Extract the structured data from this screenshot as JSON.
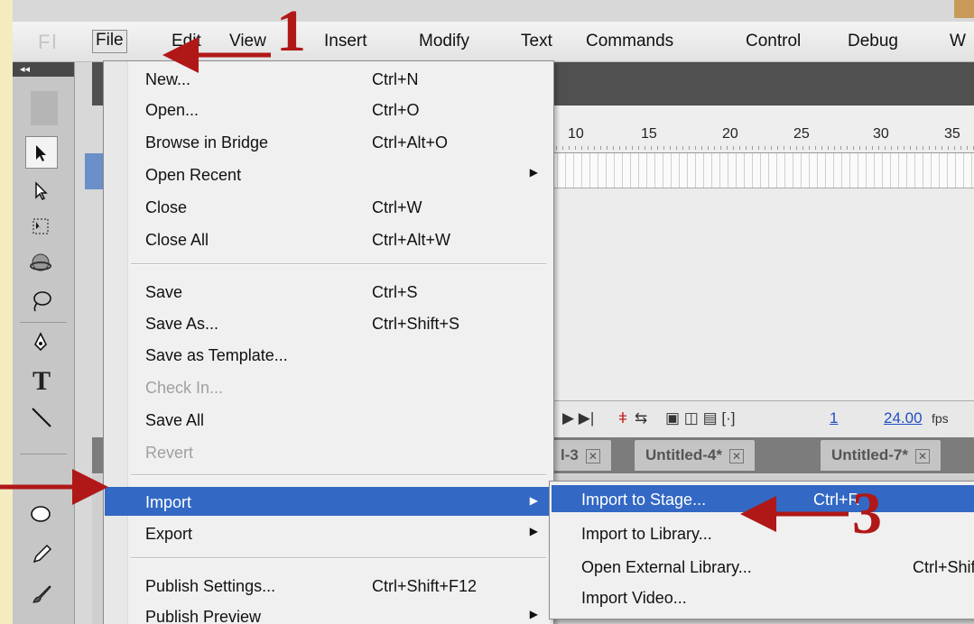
{
  "app": {
    "logo": "Fl"
  },
  "menubar": {
    "items": [
      {
        "label": "File"
      },
      {
        "label": "Edit"
      },
      {
        "label": "View"
      },
      {
        "label": "Insert"
      },
      {
        "label": "Modify"
      },
      {
        "label": "Text"
      },
      {
        "label": "Commands"
      },
      {
        "label": "Control"
      },
      {
        "label": "Debug"
      },
      {
        "label": "W"
      }
    ]
  },
  "toolbar": {
    "collapse_label": "◂◂"
  },
  "timeline": {
    "ruler": [
      "10",
      "15",
      "20",
      "25",
      "30",
      "35"
    ],
    "frame": "1",
    "fps_value": "24.00",
    "fps_unit": "fps"
  },
  "doc_tabs": [
    {
      "label": "l-3"
    },
    {
      "label": "Untitled-4*"
    },
    {
      "label": "Untitled-7*"
    }
  ],
  "file_menu": {
    "items": [
      {
        "label": "New...",
        "shortcut": "Ctrl+N"
      },
      {
        "label": "Open...",
        "shortcut": "Ctrl+O"
      },
      {
        "label": "Browse in Bridge",
        "shortcut": "Ctrl+Alt+O"
      },
      {
        "label": "Open Recent",
        "shortcut": ""
      },
      {
        "label": "Close",
        "shortcut": "Ctrl+W"
      },
      {
        "label": "Close All",
        "shortcut": "Ctrl+Alt+W"
      },
      {
        "label": "Save",
        "shortcut": "Ctrl+S"
      },
      {
        "label": "Save As...",
        "shortcut": "Ctrl+Shift+S"
      },
      {
        "label": "Save as Template...",
        "shortcut": ""
      },
      {
        "label": "Check In...",
        "shortcut": ""
      },
      {
        "label": "Save All",
        "shortcut": ""
      },
      {
        "label": "Revert",
        "shortcut": ""
      },
      {
        "label": "Import",
        "shortcut": ""
      },
      {
        "label": "Export",
        "shortcut": ""
      },
      {
        "label": "Publish Settings...",
        "shortcut": "Ctrl+Shift+F12"
      },
      {
        "label": "Publish Preview",
        "shortcut": ""
      }
    ]
  },
  "import_submenu": {
    "items": [
      {
        "label": "Import to Stage...",
        "shortcut": "Ctrl+R"
      },
      {
        "label": "Import to Library...",
        "shortcut": ""
      },
      {
        "label": "Open External Library...",
        "shortcut": "Ctrl+Shift+O"
      },
      {
        "label": "Import Video...",
        "shortcut": ""
      }
    ]
  },
  "annotations": {
    "step1": "1",
    "step3": "3",
    "color": "#b01818"
  },
  "colors": {
    "highlight": "#3368c4",
    "page_bg": "#f5ebc0"
  }
}
